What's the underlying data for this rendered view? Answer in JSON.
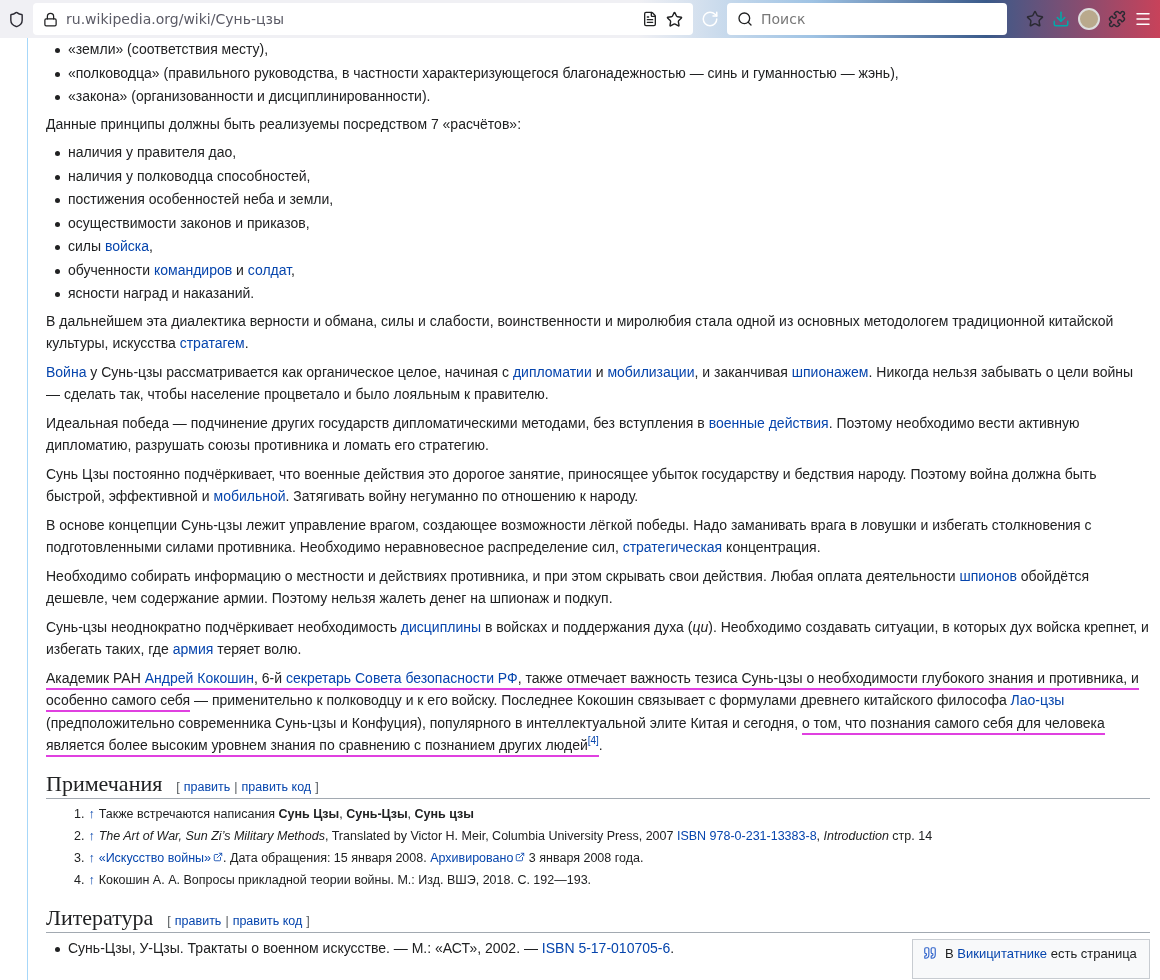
{
  "browser": {
    "url": "ru.wikipedia.org/wiki/Сунь-цзы",
    "search_placeholder": "Поиск"
  },
  "blocks": [
    {
      "kind": "bullets",
      "items": [
        [
          {
            "t": "«земли» (соответствия месту),"
          }
        ],
        [
          {
            "t": "«полководца» (правильного руководства, в частности характеризующегося благонадежностью — синь и гуманностью — жэнь),"
          }
        ],
        [
          {
            "t": "«закона» (организованности и дисциплинированности)."
          }
        ]
      ]
    },
    {
      "kind": "paragraph",
      "parts": [
        {
          "t": "Данные принципы должны быть реализуемы посредством 7 «расчётов»:"
        }
      ]
    },
    {
      "kind": "bullets",
      "items": [
        [
          {
            "t": "наличия у правителя дао,"
          }
        ],
        [
          {
            "t": "наличия у полководца способностей,"
          }
        ],
        [
          {
            "t": "постижения особенностей неба и земли,"
          }
        ],
        [
          {
            "t": "осуществимости законов и приказов,"
          }
        ],
        [
          {
            "t": "силы "
          },
          {
            "t": "войска",
            "link": true
          },
          {
            "t": ","
          }
        ],
        [
          {
            "t": "обученности "
          },
          {
            "t": "командиров",
            "link": true
          },
          {
            "t": " и "
          },
          {
            "t": "солдат",
            "link": true
          },
          {
            "t": ","
          }
        ],
        [
          {
            "t": "ясности наград и наказаний."
          }
        ]
      ]
    },
    {
      "kind": "paragraph",
      "parts": [
        {
          "t": "В дальнейшем эта диалектика верности и обмана, силы и слабости, воинственности и миролюбия стала одной из основных методологем традиционной китайской культуры, искусства "
        },
        {
          "t": "стратагем",
          "link": true
        },
        {
          "t": "."
        }
      ]
    },
    {
      "kind": "paragraph",
      "parts": [
        {
          "t": "Война",
          "link": true
        },
        {
          "t": " у Сунь-цзы рассматривается как органическое целое, начиная с "
        },
        {
          "t": "дипломатии",
          "link": true
        },
        {
          "t": " и "
        },
        {
          "t": "мобилизации",
          "link": true
        },
        {
          "t": ", и заканчивая "
        },
        {
          "t": "шпионажем",
          "link": true
        },
        {
          "t": ". Никогда нельзя забывать о цели войны — сделать так, чтобы население процветало и было лояльным к правителю."
        }
      ]
    },
    {
      "kind": "paragraph",
      "parts": [
        {
          "t": "Идеальная победа — подчинение других государств дипломатическими методами, без вступления в "
        },
        {
          "t": "военные действия",
          "link": true
        },
        {
          "t": ". Поэтому необходимо вести активную дипломатию, разрушать союзы противника и ломать его стратегию."
        }
      ]
    },
    {
      "kind": "paragraph",
      "parts": [
        {
          "t": "Сунь Цзы постоянно подчёркивает, что военные действия это дорогое занятие, приносящее убыток государству и бедствия народу. Поэтому война должна быть быстрой, эффективной и "
        },
        {
          "t": "мобильной",
          "link": true
        },
        {
          "t": ". Затягивать войну негуманно по отношению к народу."
        }
      ]
    },
    {
      "kind": "paragraph",
      "parts": [
        {
          "t": "В основе концепции Сунь-цзы лежит управление врагом, создающее возможности лёгкой победы. Надо заманивать врага в ловушки и избегать столкновения с подготовленными силами противника. Необходимо неравновесное распределение сил, "
        },
        {
          "t": "стратегическая",
          "link": true
        },
        {
          "t": " концентрация."
        }
      ]
    },
    {
      "kind": "paragraph",
      "parts": [
        {
          "t": "Необходимо собирать информацию о местности и действиях противника, и при этом скрывать свои действия. Любая оплата деятельности "
        },
        {
          "t": "шпионов",
          "link": true
        },
        {
          "t": " обойдётся дешевле, чем содержание армии. Поэтому нельзя жалеть денег на шпионаж и подкуп."
        }
      ]
    },
    {
      "kind": "paragraph",
      "parts": [
        {
          "t": "Сунь-цзы неоднократно подчёркивает необходимость "
        },
        {
          "t": "дисциплины",
          "link": true
        },
        {
          "t": " в войсках и поддержания духа (*ци*). Необходимо создавать ситуации, в которых дух войска крепнет, и избегать таких, где "
        },
        {
          "t": "армия",
          "link": true
        },
        {
          "t": " теряет волю."
        }
      ]
    },
    {
      "kind": "paragraph",
      "parts": [
        {
          "t": "Академик РАН ",
          "marked": true
        },
        {
          "t": "Андрей Кокошин",
          "link": true,
          "marked": true
        },
        {
          "t": ", 6-й ",
          "marked": true
        },
        {
          "t": "секретарь Совета безопасности РФ",
          "link": true,
          "marked": true
        },
        {
          "t": ", также отмечает важность тезиса Сунь-цзы о необходимости глубокого знания и противника, и особенно самого себя",
          "marked": true
        },
        {
          "t": " — применительно к полководцу и к его войску. Последнее Кокошин связывает с формулами древнего китайского философа "
        },
        {
          "t": "Лао-цзы",
          "link": true
        },
        {
          "t": " (предположительно современника Сунь-цзы и Конфуция), популярного в интеллектуальной элите Китая и сегодня, "
        },
        {
          "t": "о том, что познания самого себя для человека является более высоким уровнем знания по сравнению с познанием других людей",
          "marked": true
        },
        {
          "t": "[4]",
          "link": true,
          "sup": true,
          "marked": true
        },
        {
          "t": "."
        }
      ]
    },
    {
      "kind": "heading",
      "title": "Примечания",
      "open": "[",
      "separator": "|",
      "close": "]",
      "edit_links": [
        "править",
        "править код"
      ]
    },
    {
      "kind": "notes",
      "items": [
        {
          "number": "1.",
          "arrow": "↑",
          "parts": [
            {
              "t": "Также встречаются написания **Сунь Цзы**, **Сунь-Цзы**, **Сунь цзы**"
            }
          ]
        },
        {
          "number": "2.",
          "arrow": "↑",
          "parts": [
            {
              "t": "*The Art of War, Sun Zi’s Military Methods*, Translated by Victor H. Meir, Columbia University Press, 2007 "
            },
            {
              "t": "ISBN 978-0-231-13383-8",
              "link": true
            },
            {
              "t": ", *Introduction* стр. 14"
            }
          ]
        },
        {
          "number": "3.",
          "arrow": "↑",
          "parts": [
            {
              "t": "«Искусство войны»",
              "link": true,
              "external": true
            },
            {
              "t": ". Дата обращения: 15 января 2008. "
            },
            {
              "t": "Архивировано",
              "link": true,
              "external": true
            },
            {
              "t": " 3 января 2008 года."
            }
          ]
        },
        {
          "number": "4.",
          "arrow": "↑",
          "parts": [
            {
              "t": "Кокошин А. А. Вопросы прикладной теории войны. М.: Изд. ВШЭ, 2018. С. 192—193."
            }
          ]
        }
      ]
    },
    {
      "kind": "heading",
      "title": "Литература",
      "open": "[",
      "separator": "|",
      "close": "]",
      "edit_links": [
        "править",
        "править код"
      ],
      "sidebox": [
        {
          "t": "В "
        },
        {
          "t": "Викицитатнике",
          "link": true
        },
        {
          "t": " есть страница"
        }
      ]
    },
    {
      "kind": "bullets",
      "items": [
        [
          {
            "t": "Сунь-Цзы, У-Цзы. Трактаты о военном искусстве. — М.: «АСТ», 2002. — "
          },
          {
            "t": "ISBN 5-17-010705-6",
            "link": true
          },
          {
            "t": "."
          }
        ]
      ]
    }
  ]
}
